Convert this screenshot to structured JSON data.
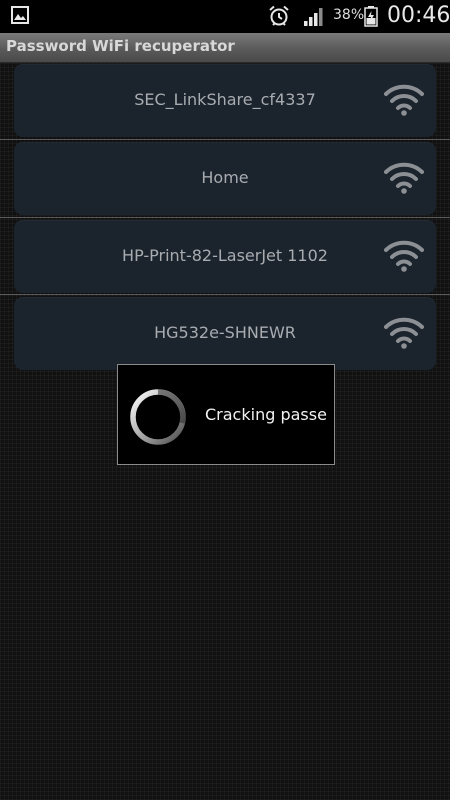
{
  "status_bar": {
    "battery_percent": "38%",
    "clock": "00:46",
    "icons": [
      "gallery-icon",
      "alarm-icon",
      "signal-icon",
      "battery-icon"
    ]
  },
  "app": {
    "title": "Password WiFi recuperator"
  },
  "networks": [
    {
      "ssid": "SEC_LinkShare_cf4337",
      "icon": "wifi-icon"
    },
    {
      "ssid": "Home",
      "icon": "wifi-icon"
    },
    {
      "ssid": "HP-Print-82-LaserJet 1102",
      "icon": "wifi-icon"
    },
    {
      "ssid": "HG532e-SHNEWR",
      "icon": "wifi-icon"
    }
  ],
  "dialog": {
    "message": "Cracking passe"
  },
  "colors": {
    "card_background": "#1b242d",
    "ssid_text": "#a8acb0",
    "title_bar": "#5a5a5a"
  }
}
